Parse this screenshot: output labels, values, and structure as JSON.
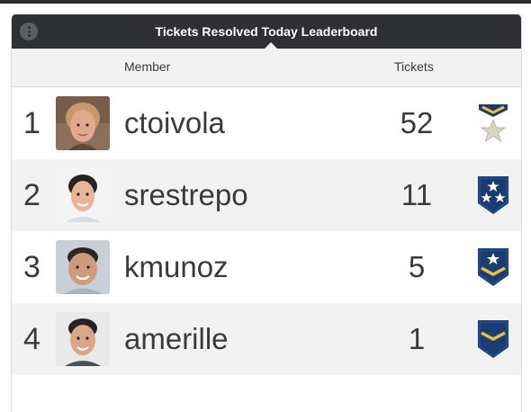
{
  "widget": {
    "title": "Tickets Resolved Today Leaderboard",
    "menu_icon": "more-options-icon"
  },
  "columns": {
    "member": "Member",
    "tickets": "Tickets"
  },
  "rows": [
    {
      "rank": "1",
      "member": "ctoivola",
      "tickets": "52",
      "badge_icon": "medal-star-icon"
    },
    {
      "rank": "2",
      "member": "srestrepo",
      "tickets": "11",
      "badge_icon": "shield-two-stars-icon"
    },
    {
      "rank": "3",
      "member": "kmunoz",
      "tickets": "5",
      "badge_icon": "shield-star-chevron-icon"
    },
    {
      "rank": "4",
      "member": "amerille",
      "tickets": "1",
      "badge_icon": "shield-chevron-icon"
    }
  ],
  "colors": {
    "header_bg": "#2e3033",
    "badge_navy": "#1b3b73",
    "badge_gold": "#e9c13a",
    "row_alt": "#f2f2f2"
  }
}
